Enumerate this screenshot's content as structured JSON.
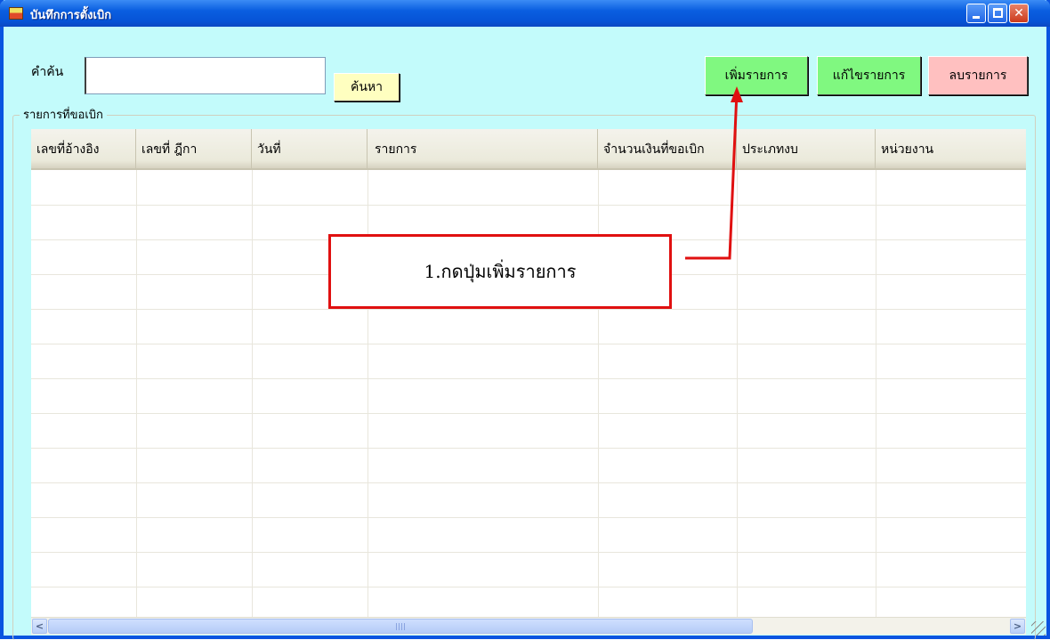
{
  "window": {
    "title": "บันทึกการตั้งเบิก"
  },
  "toolbar": {
    "search_label": "คำค้น",
    "search_value": "",
    "search_button": "ค้นหา",
    "add_button": "เพิ่มรายการ",
    "edit_button": "แก้ไขรายการ",
    "delete_button": "ลบรายการ"
  },
  "group": {
    "legend": "รายการที่ขอเบิก"
  },
  "grid": {
    "columns": [
      "เลขที่อ้างอิง",
      "เลขที่ ฎีกา",
      "วันที่",
      "รายการ",
      "จำนวนเงินที่ขอเบิก",
      "ประเภทงบ",
      "หน่วยงาน"
    ],
    "rows": []
  },
  "annotation": {
    "text": "1.กดปุ่มเพิ่มรายการ",
    "color": "#e01010"
  },
  "colors": {
    "window_bg": "#c3fbfb",
    "title_bar": "#0a5ee0",
    "search_button_bg": "#ffffc0",
    "add_button_bg": "#80f880",
    "edit_button_bg": "#80f880",
    "delete_button_bg": "#ffc0c0"
  }
}
